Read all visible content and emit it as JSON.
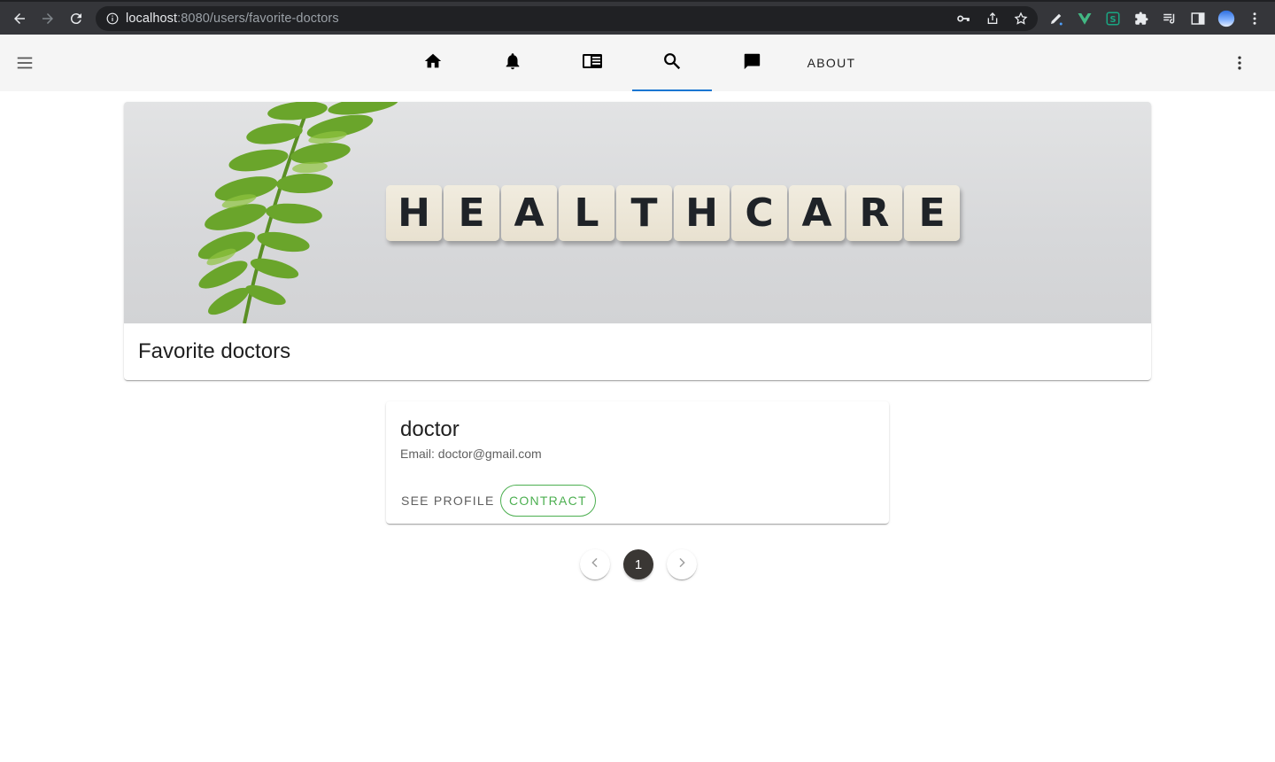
{
  "browser": {
    "url_host": "localhost",
    "url_rest": ":8080/users/favorite-doctors"
  },
  "app_bar": {
    "tabs": [
      {
        "icon": "home-icon"
      },
      {
        "icon": "bell-icon"
      },
      {
        "icon": "newspaper-icon"
      },
      {
        "icon": "search-icon",
        "active": true
      },
      {
        "icon": "chat-icon"
      }
    ],
    "about_label": "ABOUT",
    "accent_color": "#1976d2"
  },
  "banner": {
    "tiles": [
      "H",
      "E",
      "A",
      "L",
      "T",
      "H",
      "C",
      "A",
      "R",
      "E"
    ],
    "title": "Favorite doctors"
  },
  "doctors": [
    {
      "name": "doctor",
      "email": "Email: doctor@gmail.com",
      "see_profile_label": "SEE PROFILE",
      "contract_label": "CONTRACT",
      "contract_color": "#4caf50"
    }
  ],
  "pagination": {
    "current_page": "1"
  }
}
